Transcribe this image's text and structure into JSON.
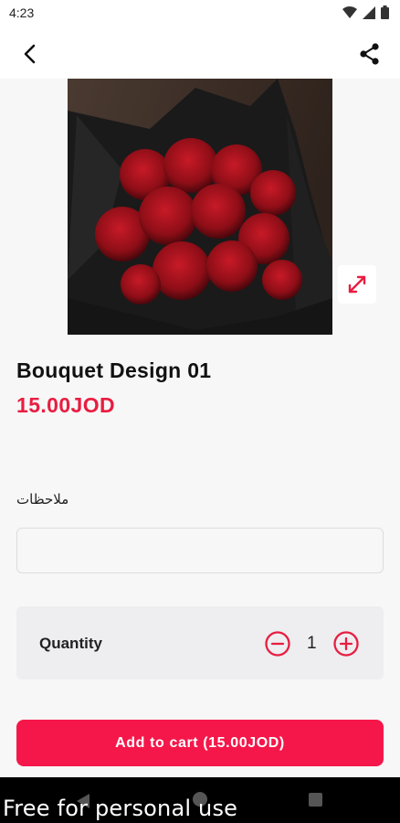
{
  "status_bar": {
    "time": "4:23"
  },
  "product": {
    "title": "Bouquet Design 01",
    "price": "15.00JOD",
    "image_icon": "rose-bouquet-image"
  },
  "notes": {
    "label": "ملاحظات",
    "value": "",
    "placeholder": ""
  },
  "quantity": {
    "label": "Quantity",
    "value": "1"
  },
  "cart": {
    "button_label": "Add to cart (15.00JOD)"
  },
  "watermark": "Free for personal use",
  "colors": {
    "accent": "#f5174a",
    "price": "#e81d41",
    "panel": "#eeedf0"
  },
  "icons": [
    "wifi-icon",
    "signal-icon",
    "battery-icon",
    "back-arrow-icon",
    "share-icon",
    "expand-icon",
    "minus-circle-icon",
    "plus-circle-icon",
    "nav-back-icon",
    "nav-home-icon",
    "nav-recent-icon"
  ]
}
